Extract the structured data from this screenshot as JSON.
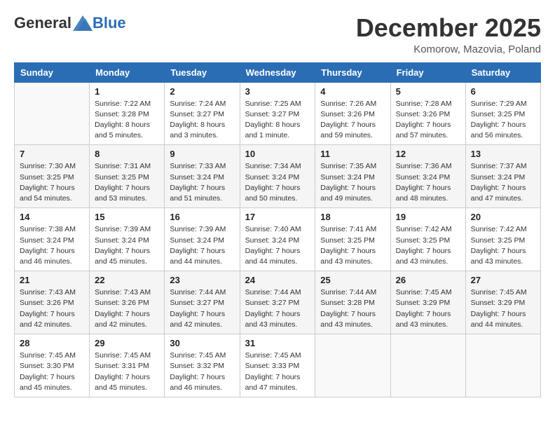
{
  "header": {
    "logo_general": "General",
    "logo_blue": "Blue",
    "main_title": "December 2025",
    "subtitle": "Komorow, Mazovia, Poland"
  },
  "calendar": {
    "days_of_week": [
      "Sunday",
      "Monday",
      "Tuesday",
      "Wednesday",
      "Thursday",
      "Friday",
      "Saturday"
    ],
    "weeks": [
      [
        {
          "day": "",
          "info": ""
        },
        {
          "day": "1",
          "info": "Sunrise: 7:22 AM\nSunset: 3:28 PM\nDaylight: 8 hours\nand 5 minutes."
        },
        {
          "day": "2",
          "info": "Sunrise: 7:24 AM\nSunset: 3:27 PM\nDaylight: 8 hours\nand 3 minutes."
        },
        {
          "day": "3",
          "info": "Sunrise: 7:25 AM\nSunset: 3:27 PM\nDaylight: 8 hours\nand 1 minute."
        },
        {
          "day": "4",
          "info": "Sunrise: 7:26 AM\nSunset: 3:26 PM\nDaylight: 7 hours\nand 59 minutes."
        },
        {
          "day": "5",
          "info": "Sunrise: 7:28 AM\nSunset: 3:26 PM\nDaylight: 7 hours\nand 57 minutes."
        },
        {
          "day": "6",
          "info": "Sunrise: 7:29 AM\nSunset: 3:25 PM\nDaylight: 7 hours\nand 56 minutes."
        }
      ],
      [
        {
          "day": "7",
          "info": "Sunrise: 7:30 AM\nSunset: 3:25 PM\nDaylight: 7 hours\nand 54 minutes."
        },
        {
          "day": "8",
          "info": "Sunrise: 7:31 AM\nSunset: 3:25 PM\nDaylight: 7 hours\nand 53 minutes."
        },
        {
          "day": "9",
          "info": "Sunrise: 7:33 AM\nSunset: 3:24 PM\nDaylight: 7 hours\nand 51 minutes."
        },
        {
          "day": "10",
          "info": "Sunrise: 7:34 AM\nSunset: 3:24 PM\nDaylight: 7 hours\nand 50 minutes."
        },
        {
          "day": "11",
          "info": "Sunrise: 7:35 AM\nSunset: 3:24 PM\nDaylight: 7 hours\nand 49 minutes."
        },
        {
          "day": "12",
          "info": "Sunrise: 7:36 AM\nSunset: 3:24 PM\nDaylight: 7 hours\nand 48 minutes."
        },
        {
          "day": "13",
          "info": "Sunrise: 7:37 AM\nSunset: 3:24 PM\nDaylight: 7 hours\nand 47 minutes."
        }
      ],
      [
        {
          "day": "14",
          "info": "Sunrise: 7:38 AM\nSunset: 3:24 PM\nDaylight: 7 hours\nand 46 minutes."
        },
        {
          "day": "15",
          "info": "Sunrise: 7:39 AM\nSunset: 3:24 PM\nDaylight: 7 hours\nand 45 minutes."
        },
        {
          "day": "16",
          "info": "Sunrise: 7:39 AM\nSunset: 3:24 PM\nDaylight: 7 hours\nand 44 minutes."
        },
        {
          "day": "17",
          "info": "Sunrise: 7:40 AM\nSunset: 3:24 PM\nDaylight: 7 hours\nand 44 minutes."
        },
        {
          "day": "18",
          "info": "Sunrise: 7:41 AM\nSunset: 3:25 PM\nDaylight: 7 hours\nand 43 minutes."
        },
        {
          "day": "19",
          "info": "Sunrise: 7:42 AM\nSunset: 3:25 PM\nDaylight: 7 hours\nand 43 minutes."
        },
        {
          "day": "20",
          "info": "Sunrise: 7:42 AM\nSunset: 3:25 PM\nDaylight: 7 hours\nand 43 minutes."
        }
      ],
      [
        {
          "day": "21",
          "info": "Sunrise: 7:43 AM\nSunset: 3:26 PM\nDaylight: 7 hours\nand 42 minutes."
        },
        {
          "day": "22",
          "info": "Sunrise: 7:43 AM\nSunset: 3:26 PM\nDaylight: 7 hours\nand 42 minutes."
        },
        {
          "day": "23",
          "info": "Sunrise: 7:44 AM\nSunset: 3:27 PM\nDaylight: 7 hours\nand 42 minutes."
        },
        {
          "day": "24",
          "info": "Sunrise: 7:44 AM\nSunset: 3:27 PM\nDaylight: 7 hours\nand 43 minutes."
        },
        {
          "day": "25",
          "info": "Sunrise: 7:44 AM\nSunset: 3:28 PM\nDaylight: 7 hours\nand 43 minutes."
        },
        {
          "day": "26",
          "info": "Sunrise: 7:45 AM\nSunset: 3:29 PM\nDaylight: 7 hours\nand 43 minutes."
        },
        {
          "day": "27",
          "info": "Sunrise: 7:45 AM\nSunset: 3:29 PM\nDaylight: 7 hours\nand 44 minutes."
        }
      ],
      [
        {
          "day": "28",
          "info": "Sunrise: 7:45 AM\nSunset: 3:30 PM\nDaylight: 7 hours\nand 45 minutes."
        },
        {
          "day": "29",
          "info": "Sunrise: 7:45 AM\nSunset: 3:31 PM\nDaylight: 7 hours\nand 45 minutes."
        },
        {
          "day": "30",
          "info": "Sunrise: 7:45 AM\nSunset: 3:32 PM\nDaylight: 7 hours\nand 46 minutes."
        },
        {
          "day": "31",
          "info": "Sunrise: 7:45 AM\nSunset: 3:33 PM\nDaylight: 7 hours\nand 47 minutes."
        },
        {
          "day": "",
          "info": ""
        },
        {
          "day": "",
          "info": ""
        },
        {
          "day": "",
          "info": ""
        }
      ]
    ]
  }
}
